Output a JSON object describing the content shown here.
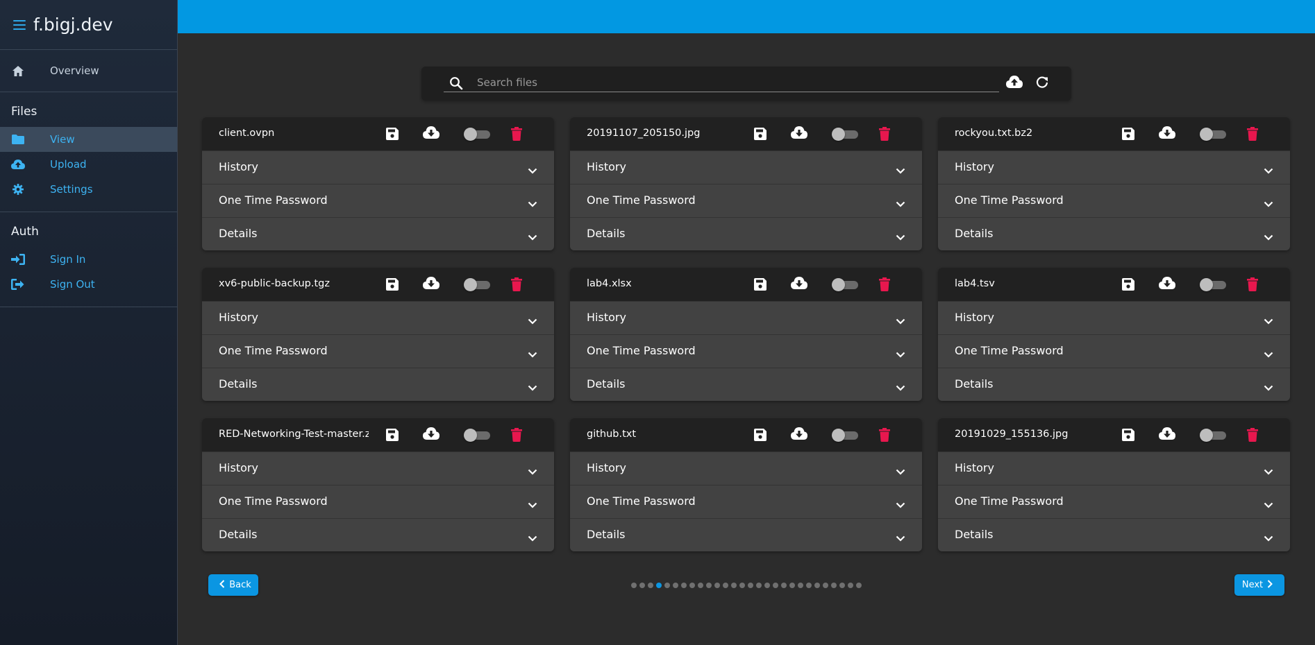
{
  "app": {
    "title": "f.bigj.dev"
  },
  "sidebar": {
    "overview": {
      "label": "Overview"
    },
    "files": {
      "title": "Files",
      "items": [
        {
          "label": "View",
          "icon": "folder-icon",
          "active": true
        },
        {
          "label": "Upload",
          "icon": "cloud-upload-icon",
          "active": false
        },
        {
          "label": "Settings",
          "icon": "gear-icon",
          "active": false
        }
      ]
    },
    "auth": {
      "title": "Auth",
      "items": [
        {
          "label": "Sign In",
          "icon": "sign-in-icon"
        },
        {
          "label": "Sign Out",
          "icon": "sign-out-icon"
        }
      ]
    }
  },
  "search": {
    "placeholder": "Search files",
    "value": ""
  },
  "files": [
    {
      "name": "client.ovpn",
      "panels": [
        "History",
        "One Time Password",
        "Details"
      ]
    },
    {
      "name": "20191107_205150.jpg",
      "panels": [
        "History",
        "One Time Password",
        "Details"
      ]
    },
    {
      "name": "rockyou.txt.bz2",
      "panels": [
        "History",
        "One Time Password",
        "Details"
      ]
    },
    {
      "name": "xv6-public-backup.tgz",
      "panels": [
        "History",
        "One Time Password",
        "Details"
      ]
    },
    {
      "name": "lab4.xlsx",
      "panels": [
        "History",
        "One Time Password",
        "Details"
      ]
    },
    {
      "name": "lab4.tsv",
      "panels": [
        "History",
        "One Time Password",
        "Details"
      ]
    },
    {
      "name": "RED-Networking-Test-master.zi",
      "panels": [
        "History",
        "One Time Password",
        "Details"
      ]
    },
    {
      "name": "github.txt",
      "panels": [
        "History",
        "One Time Password",
        "Details"
      ]
    },
    {
      "name": "20191029_155136.jpg",
      "panels": [
        "History",
        "One Time Password",
        "Details"
      ]
    }
  ],
  "pagination": {
    "back_label": "Back",
    "next_label": "Next",
    "total_pages": 28,
    "current_page": 4
  },
  "colors": {
    "accent": "#0298e2",
    "delete": "#e8174e",
    "sidebar_link": "#3db3f2"
  }
}
